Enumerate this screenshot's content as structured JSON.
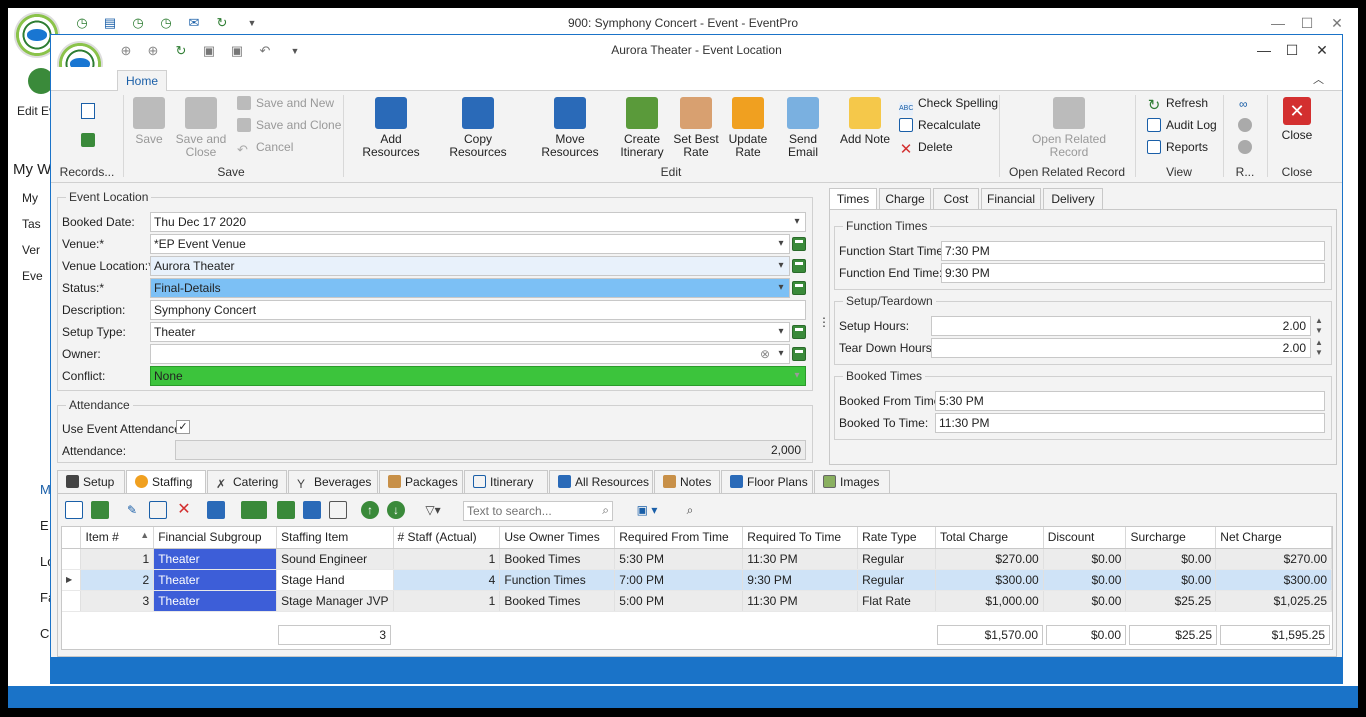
{
  "bg_window": {
    "title": "900: Symphony Concert - Event - EventPro",
    "edit_label": "Edit Ev",
    "my_label": "My W",
    "left_items": [
      "My",
      "Tas",
      "Ver",
      "Eve"
    ],
    "left_items2": [
      "M",
      "E",
      "Lo",
      "Fa",
      "C"
    ]
  },
  "window": {
    "title": "Aurora Theater - Event Location",
    "home_tab": "Home"
  },
  "ribbon": {
    "records": {
      "label": "Records..."
    },
    "save_group": {
      "label": "Save",
      "save": "Save",
      "save_close": "Save and Close",
      "save_new": "Save and New",
      "save_clone": "Save and Clone",
      "cancel": "Cancel"
    },
    "edit_group": {
      "label": "Edit",
      "add_resources": "Add Resources",
      "copy_resources": "Copy Resources",
      "move_resources": "Move Resources",
      "create_itinerary": "Create Itinerary",
      "set_best_rate": "Set Best Rate",
      "update_rate": "Update Rate",
      "send_email": "Send Email",
      "add_note": "Add Note",
      "check_spelling": "Check Spelling",
      "recalculate": "Recalculate",
      "delete": "Delete"
    },
    "open_related": {
      "label": "Open Related Record",
      "button": "Open Related Record"
    },
    "view_group": {
      "label": "View",
      "refresh": "Refresh",
      "audit_log": "Audit Log",
      "reports": "Reports"
    },
    "r_group": {
      "label": "R..."
    },
    "close_group": {
      "label": "Close",
      "close": "Close"
    }
  },
  "event_location": {
    "legend": "Event Location",
    "booked_date": {
      "label": "Booked Date:",
      "value": "Thu Dec 17 2020"
    },
    "venue": {
      "label": "Venue:*",
      "value": "*EP Event Venue"
    },
    "venue_location": {
      "label": "Venue Location:*",
      "value": "Aurora Theater"
    },
    "status": {
      "label": "Status:*",
      "value": "Final-Details"
    },
    "description": {
      "label": "Description:",
      "value": "Symphony Concert"
    },
    "setup_type": {
      "label": "Setup Type:",
      "value": "Theater"
    },
    "owner": {
      "label": "Owner:",
      "value": ""
    },
    "conflict": {
      "label": "Conflict:",
      "value": "None"
    }
  },
  "attendance": {
    "legend": "Attendance",
    "use_event": "Use Event Attendance",
    "label": "Attendance:",
    "value": "2,000"
  },
  "right_tabs": [
    "Times",
    "Charge",
    "Cost",
    "Financial",
    "Delivery"
  ],
  "function_times": {
    "legend": "Function Times",
    "start": {
      "label": "Function Start Time:",
      "value": "7:30 PM"
    },
    "end": {
      "label": "Function End Time:",
      "value": "9:30 PM"
    }
  },
  "setup_teardown": {
    "legend": "Setup/Teardown",
    "setup": {
      "label": "Setup Hours:",
      "value": "2.00"
    },
    "teardown": {
      "label": "Tear Down Hours:",
      "value": "2.00"
    }
  },
  "booked_times": {
    "legend": "Booked Times",
    "from": {
      "label": "Booked From Time:",
      "value": "5:30 PM"
    },
    "to": {
      "label": "Booked To Time:",
      "value": "11:30 PM"
    }
  },
  "bottom_tabs": [
    "Setup",
    "Staffing",
    "Catering",
    "Beverages",
    "Packages",
    "Itinerary",
    "All Resources",
    "Notes",
    "Floor Plans",
    "Images"
  ],
  "search": {
    "placeholder": "Text to search..."
  },
  "grid": {
    "columns": [
      "Item #",
      "Financial Subgroup",
      "Staffing Item",
      "# Staff (Actual)",
      "Use Owner Times",
      "Required From Time",
      "Required To Time",
      "Rate Type",
      "Total Charge",
      "Discount",
      "Surcharge",
      "Net Charge"
    ],
    "rows": [
      [
        "1",
        "Theater",
        "Sound Engineer",
        "1",
        "Booked Times",
        "5:30 PM",
        "11:30 PM",
        "Regular",
        "$270.00",
        "$0.00",
        "$0.00",
        "$270.00"
      ],
      [
        "2",
        "Theater",
        "Stage Hand",
        "4",
        "Function Times",
        "7:00 PM",
        "9:30 PM",
        "Regular",
        "$300.00",
        "$0.00",
        "$0.00",
        "$300.00"
      ],
      [
        "3",
        "Theater",
        "Stage Manager JVP",
        "1",
        "Booked Times",
        "5:00 PM",
        "11:30 PM",
        "Flat Rate",
        "$1,000.00",
        "$0.00",
        "$25.25",
        "$1,025.25"
      ]
    ],
    "footer": {
      "staff": "3",
      "total": "$1,570.00",
      "discount": "$0.00",
      "surcharge": "$25.25",
      "net": "$1,595.25"
    }
  },
  "colors": {
    "accent": "#1a73c8",
    "status_bg": "#7cc0f5",
    "conflict_bg": "#3cc43c",
    "subgroup_bg": "#3d5ed8"
  }
}
